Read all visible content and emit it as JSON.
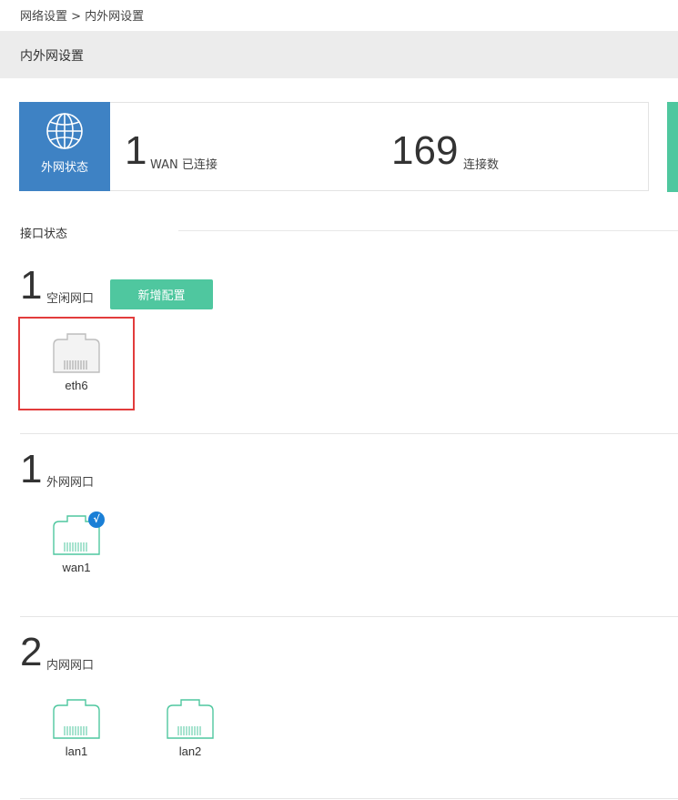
{
  "breadcrumb": "网络设置 > 内外网设置",
  "page_title": "内外网设置",
  "wan_status": {
    "tile_label": "外网状态",
    "wan_count": "1",
    "wan_label": "WAN 已连接",
    "conn_count": "169",
    "conn_label": "连接数"
  },
  "interface_section": "接口状态",
  "groups": {
    "idle": {
      "count": "1",
      "label": "空闲网口",
      "add_button": "新增配置",
      "ports": [
        "eth6"
      ]
    },
    "wan": {
      "count": "1",
      "label": "外网网口",
      "ports": [
        "wan1"
      ],
      "badge": "√"
    },
    "lan": {
      "count": "2",
      "label": "内网网口",
      "ports": [
        "lan1",
        "lan2"
      ]
    }
  },
  "colors": {
    "wan_tile": "#3e82c4",
    "accent_green": "#4fc79f",
    "idle_port": "#bdbdbd",
    "active_port": "#4fc79f",
    "highlight": "#e23c3c"
  },
  "icons": [
    "globe-icon",
    "ethernet-port-icon",
    "check-badge-icon"
  ]
}
